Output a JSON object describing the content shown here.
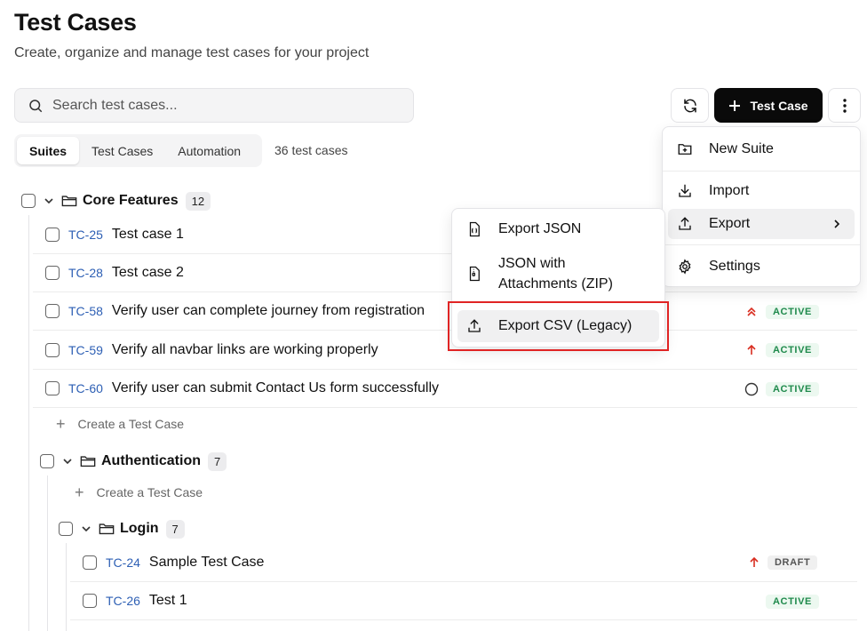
{
  "header": {
    "title": "Test Cases",
    "subtitle": "Create, organize and manage test cases for your project"
  },
  "search": {
    "placeholder": "Search test cases..."
  },
  "toolbar": {
    "new_test_case_label": "Test Case"
  },
  "tabs": [
    {
      "label": "Suites",
      "active": true
    },
    {
      "label": "Test Cases",
      "active": false
    },
    {
      "label": "Automation",
      "active": false
    }
  ],
  "count_label": "36 test cases",
  "suites": {
    "core": {
      "name": "Core Features",
      "count": "12",
      "cases": [
        {
          "id": "TC-25",
          "title": "Test case 1"
        },
        {
          "id": "TC-28",
          "title": "Test case 2"
        },
        {
          "id": "TC-58",
          "title": "Verify user can complete journey from registration",
          "status": "ACTIVE",
          "priority": "critical"
        },
        {
          "id": "TC-59",
          "title": "Verify all navbar links are working properly",
          "status": "ACTIVE",
          "priority": "high"
        },
        {
          "id": "TC-60",
          "title": "Verify user can submit Contact Us form successfully",
          "status": "ACTIVE",
          "priority": "none"
        }
      ],
      "create_label": "Create a Test Case"
    },
    "auth": {
      "name": "Authentication",
      "count": "7",
      "create_label": "Create a Test Case"
    },
    "login": {
      "name": "Login",
      "count": "7",
      "cases": [
        {
          "id": "TC-24",
          "title": "Sample Test Case",
          "status": "DRAFT",
          "priority": "high"
        },
        {
          "id": "TC-26",
          "title": "Test 1",
          "status": "ACTIVE"
        }
      ]
    }
  },
  "more_menu": {
    "new_suite": "New Suite",
    "import": "Import",
    "export": "Export",
    "settings": "Settings"
  },
  "export_menu": {
    "json": "Export JSON",
    "zip_line1": "JSON with",
    "zip_line2": "Attachments (ZIP)",
    "csv": "Export CSV (Legacy)"
  },
  "colors": {
    "accent_link": "#2d5fb4",
    "status_active": "#1f8a4c",
    "priority_red": "#d92d20",
    "highlight": "#e02424"
  }
}
